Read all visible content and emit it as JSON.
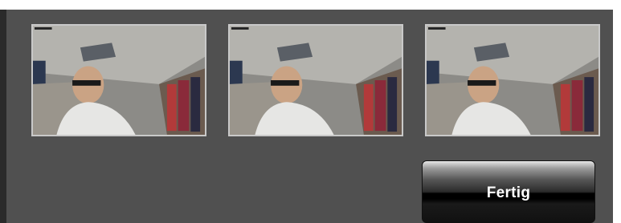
{
  "thumbnails": [
    {
      "id_label": "photo-1",
      "icon": "camera-photo"
    },
    {
      "id_label": "photo-2",
      "icon": "camera-photo"
    },
    {
      "id_label": "photo-3",
      "icon": "camera-photo"
    }
  ],
  "actions": {
    "done_label": "Fertig"
  },
  "colors": {
    "background": "#505050",
    "thumb_border": "#c9c9c9",
    "button_text": "#ffffff"
  }
}
